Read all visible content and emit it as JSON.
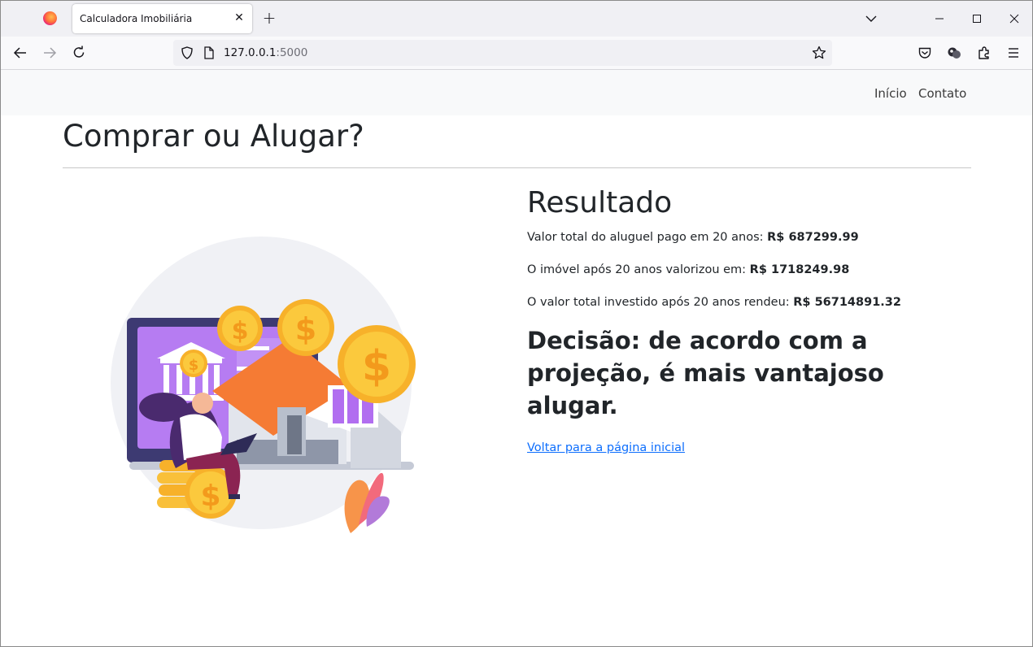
{
  "browser": {
    "tab_title": "Calculadora Imobiliária",
    "url_host": "127.0.0.1",
    "url_port": ":5000"
  },
  "site_nav": {
    "inicio": "Início",
    "contato": "Contato"
  },
  "page": {
    "title": "Comprar ou Alugar?"
  },
  "result": {
    "heading": "Resultado",
    "rent_label": "Valor total do aluguel pago em 20 anos:",
    "rent_value": "R$ 687299.99",
    "property_label": "O imóvel após 20 anos valorizou em:",
    "property_value": "R$ 1718249.98",
    "investment_label": "O valor total investido após 20 anos rendeu:",
    "investment_value": "R$ 56714891.32",
    "decision": "Decisão: de acordo com a projeção, é mais vantajoso alugar.",
    "back_link": "Voltar para a página inicial"
  },
  "colors": {
    "link": "#0d6efd",
    "coin": "#f7b12a",
    "screen": "#9b59f0",
    "roof": "#f57b34"
  }
}
